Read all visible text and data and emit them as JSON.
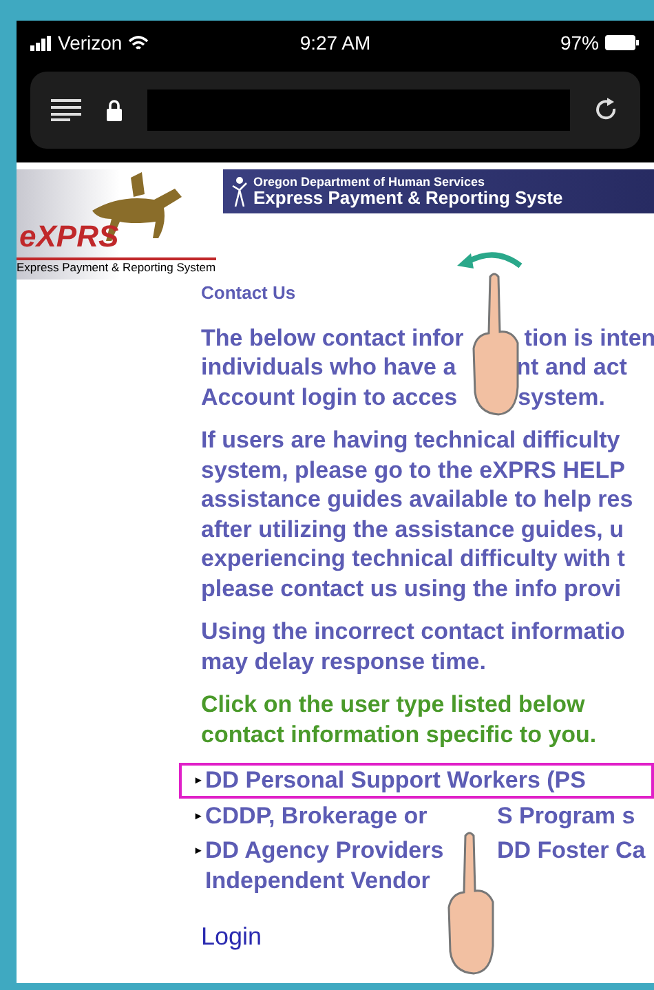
{
  "status_bar": {
    "carrier": "Verizon",
    "time": "9:27 AM",
    "battery": "97%"
  },
  "header": {
    "agency": "Oregon Department of Human Services",
    "system": "Express Payment & Reporting Syste"
  },
  "logo": {
    "name": "eXPRS",
    "tagline": "Express Payment & Reporting System"
  },
  "content": {
    "title": "Contact Us",
    "paragraphs": [
      {
        "kind": "info",
        "lines": [
          [
            "The below contact infor",
            "tion is inten"
          ],
          [
            "individuals who have a",
            "nt and act"
          ],
          [
            "Account login to acces",
            "system."
          ]
        ]
      },
      {
        "kind": "info",
        "lines": [
          [
            "If users are having technical difficulty"
          ],
          [
            "system, please go to the eXPRS HELP"
          ],
          [
            "assistance guides available to help res"
          ],
          [
            "after utilizing the assistance guides, u"
          ],
          [
            "experiencing technical difficulty with t"
          ],
          [
            "please contact us using the info provi"
          ]
        ]
      },
      {
        "kind": "info",
        "lines": [
          [
            "Using the incorrect contact informatio"
          ],
          [
            "may delay response time."
          ]
        ]
      },
      {
        "kind": "instruction",
        "lines": [
          [
            "Click on the user type listed below"
          ],
          [
            "contact information specific to you."
          ]
        ]
      }
    ],
    "links": [
      {
        "bullet": "▸",
        "lines": [
          [
            "DD Personal Support Workers (PS"
          ]
        ],
        "highlighted": true
      },
      {
        "bullet": "▸",
        "lines": [
          [
            "CDDP, Brokerage or",
            "S Program s"
          ]
        ],
        "highlighted": false
      },
      {
        "bullet": "▸",
        "lines": [
          [
            "DD Agency Providers",
            "DD Foster Ca"
          ],
          [
            "Independent Vendor"
          ]
        ],
        "highlighted": false
      }
    ],
    "login": "Login"
  }
}
